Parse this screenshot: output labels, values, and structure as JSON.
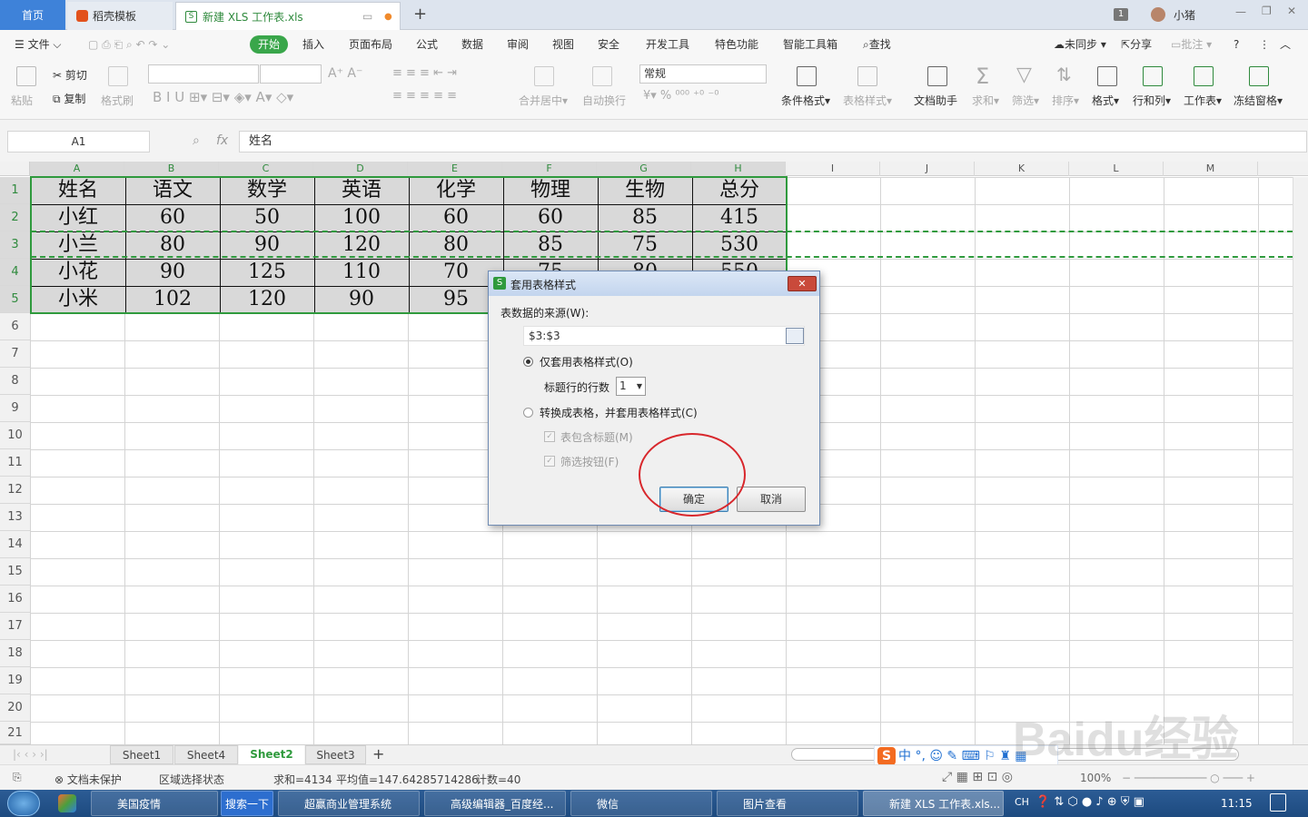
{
  "tabs": {
    "home": "首页",
    "daoke": "稻壳模板",
    "file": "新建 XLS 工作表.xls"
  },
  "user": {
    "badge": "1",
    "name": "小猪"
  },
  "menu": {
    "file": "文件",
    "start": "开始",
    "insert": "插入",
    "layout": "页面布局",
    "formula": "公式",
    "data": "数据",
    "review": "审阅",
    "view": "视图",
    "security": "安全",
    "dev": "开发工具",
    "special": "特色功能",
    "smart": "智能工具箱",
    "search": "查找",
    "sync": "未同步",
    "share": "分享",
    "comment": "批注"
  },
  "ribbon": {
    "paste": "粘贴",
    "cut": "剪切",
    "copy": "复制",
    "format_painter": "格式刷",
    "number_format": "常规",
    "merge": "合并居中",
    "wrap": "自动换行",
    "cond_format": "条件格式",
    "table_style": "表格样式",
    "doc_helper": "文档助手",
    "sum": "求和",
    "filter": "筛选",
    "sort": "排序",
    "format": "格式",
    "rowcol": "行和列",
    "sheet": "工作表",
    "freeze": "冻结窗格"
  },
  "formula_bar": {
    "cell_ref": "A1",
    "fx": "fx",
    "content": "姓名"
  },
  "columns": [
    "A",
    "B",
    "C",
    "D",
    "E",
    "F",
    "G",
    "H",
    "I",
    "J",
    "K",
    "L",
    "M"
  ],
  "rows": [
    "1",
    "2",
    "3",
    "4",
    "5",
    "6",
    "7",
    "8",
    "9",
    "10",
    "11",
    "12",
    "13",
    "14",
    "15",
    "16",
    "17",
    "18",
    "19",
    "20",
    "21"
  ],
  "table": {
    "header": [
      "姓名",
      "语文",
      "数学",
      "英语",
      "化学",
      "物理",
      "生物",
      "总分"
    ],
    "r2": [
      "小红",
      "60",
      "50",
      "100",
      "60",
      "60",
      "85",
      "415"
    ],
    "r3": [
      "小兰",
      "80",
      "90",
      "120",
      "80",
      "85",
      "75",
      "530"
    ],
    "r4": [
      "小花",
      "90",
      "125",
      "110",
      "70",
      "75",
      "80",
      "550"
    ],
    "r5": [
      "小米",
      "102",
      "120",
      "90",
      "95",
      "",
      "",
      ""
    ]
  },
  "dialog": {
    "title": "套用表格样式",
    "source_label": "表数据的来源(W):",
    "source_value": "$3:$3",
    "opt1": "仅套用表格样式(O)",
    "header_rows_label": "标题行的行数",
    "header_rows_value": "1",
    "opt2": "转换成表格，并套用表格样式(C)",
    "chk1": "表包含标题(M)",
    "chk2": "筛选按钮(F)",
    "ok": "确定",
    "cancel": "取消"
  },
  "sheets": [
    "Sheet1",
    "Sheet4",
    "Sheet2",
    "Sheet3"
  ],
  "status": {
    "protect": "文档未保护",
    "region": "区域选择状态",
    "sum": "求和=4134",
    "avg": "平均值=147.64285714286",
    "count": "计数=40",
    "zoom": "100%"
  },
  "ime": {
    "mode": "中"
  },
  "taskbar": {
    "t1": "美国疫情",
    "search": "搜索一下",
    "t2": "超赢商业管理系统",
    "t3": "高级编辑器_百度经...",
    "t4": "微信",
    "t5": "图片查看",
    "t6": "新建 XLS 工作表.xls...",
    "lang": "CH",
    "time": "11:15"
  },
  "watermark": "Baidu经验"
}
